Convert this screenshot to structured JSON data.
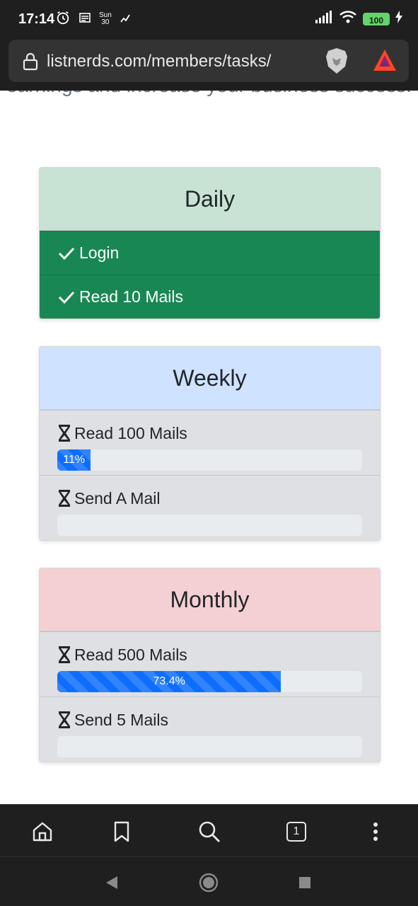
{
  "status_bar": {
    "time": "17:14",
    "day": "Sun",
    "date": "30",
    "battery": "100",
    "icons": [
      "alarm-icon",
      "notification-icon",
      "calendar-icon",
      "activity-icon",
      "signal-icon",
      "wifi-icon",
      "battery-icon",
      "charging-icon"
    ]
  },
  "browser": {
    "url": "listnerds.com/members/tasks/",
    "icons": [
      "lock-icon",
      "brave-shield-icon",
      "bat-rewards-icon"
    ]
  },
  "page": {
    "intro_text": "earnings and increase your business success."
  },
  "daily": {
    "title": "Daily",
    "color": "#198754",
    "header_color": "#c8e3d4",
    "items": [
      {
        "label": "Login",
        "status": "done"
      },
      {
        "label": "Read 10 Mails",
        "status": "done"
      }
    ]
  },
  "weekly": {
    "title": "Weekly",
    "header_color": "#cfe2ff",
    "tasks": [
      {
        "label": "Read 100 Mails",
        "progress_label": "11%",
        "progress": 11
      },
      {
        "label": "Send A Mail",
        "progress_label": "",
        "progress": 0
      }
    ]
  },
  "monthly": {
    "title": "Monthly",
    "header_color": "#f5d0d3",
    "tasks": [
      {
        "label": "Read 500 Mails",
        "progress_label": "73.4%",
        "progress": 73.4
      },
      {
        "label": "Send 5 Mails",
        "progress_label": "",
        "progress": 0
      }
    ]
  },
  "bottom_nav": {
    "tab_count": "1",
    "icons": [
      "home-icon",
      "bookmark-icon",
      "search-icon",
      "tabs-icon",
      "more-icon"
    ]
  },
  "system_nav": {
    "icons": [
      "back-icon",
      "home-circle-icon",
      "recents-icon"
    ]
  },
  "colors": {
    "progress_bar": "#0d6efd",
    "progress_track": "#e9ecef",
    "task_bg": "#dee0e3"
  }
}
